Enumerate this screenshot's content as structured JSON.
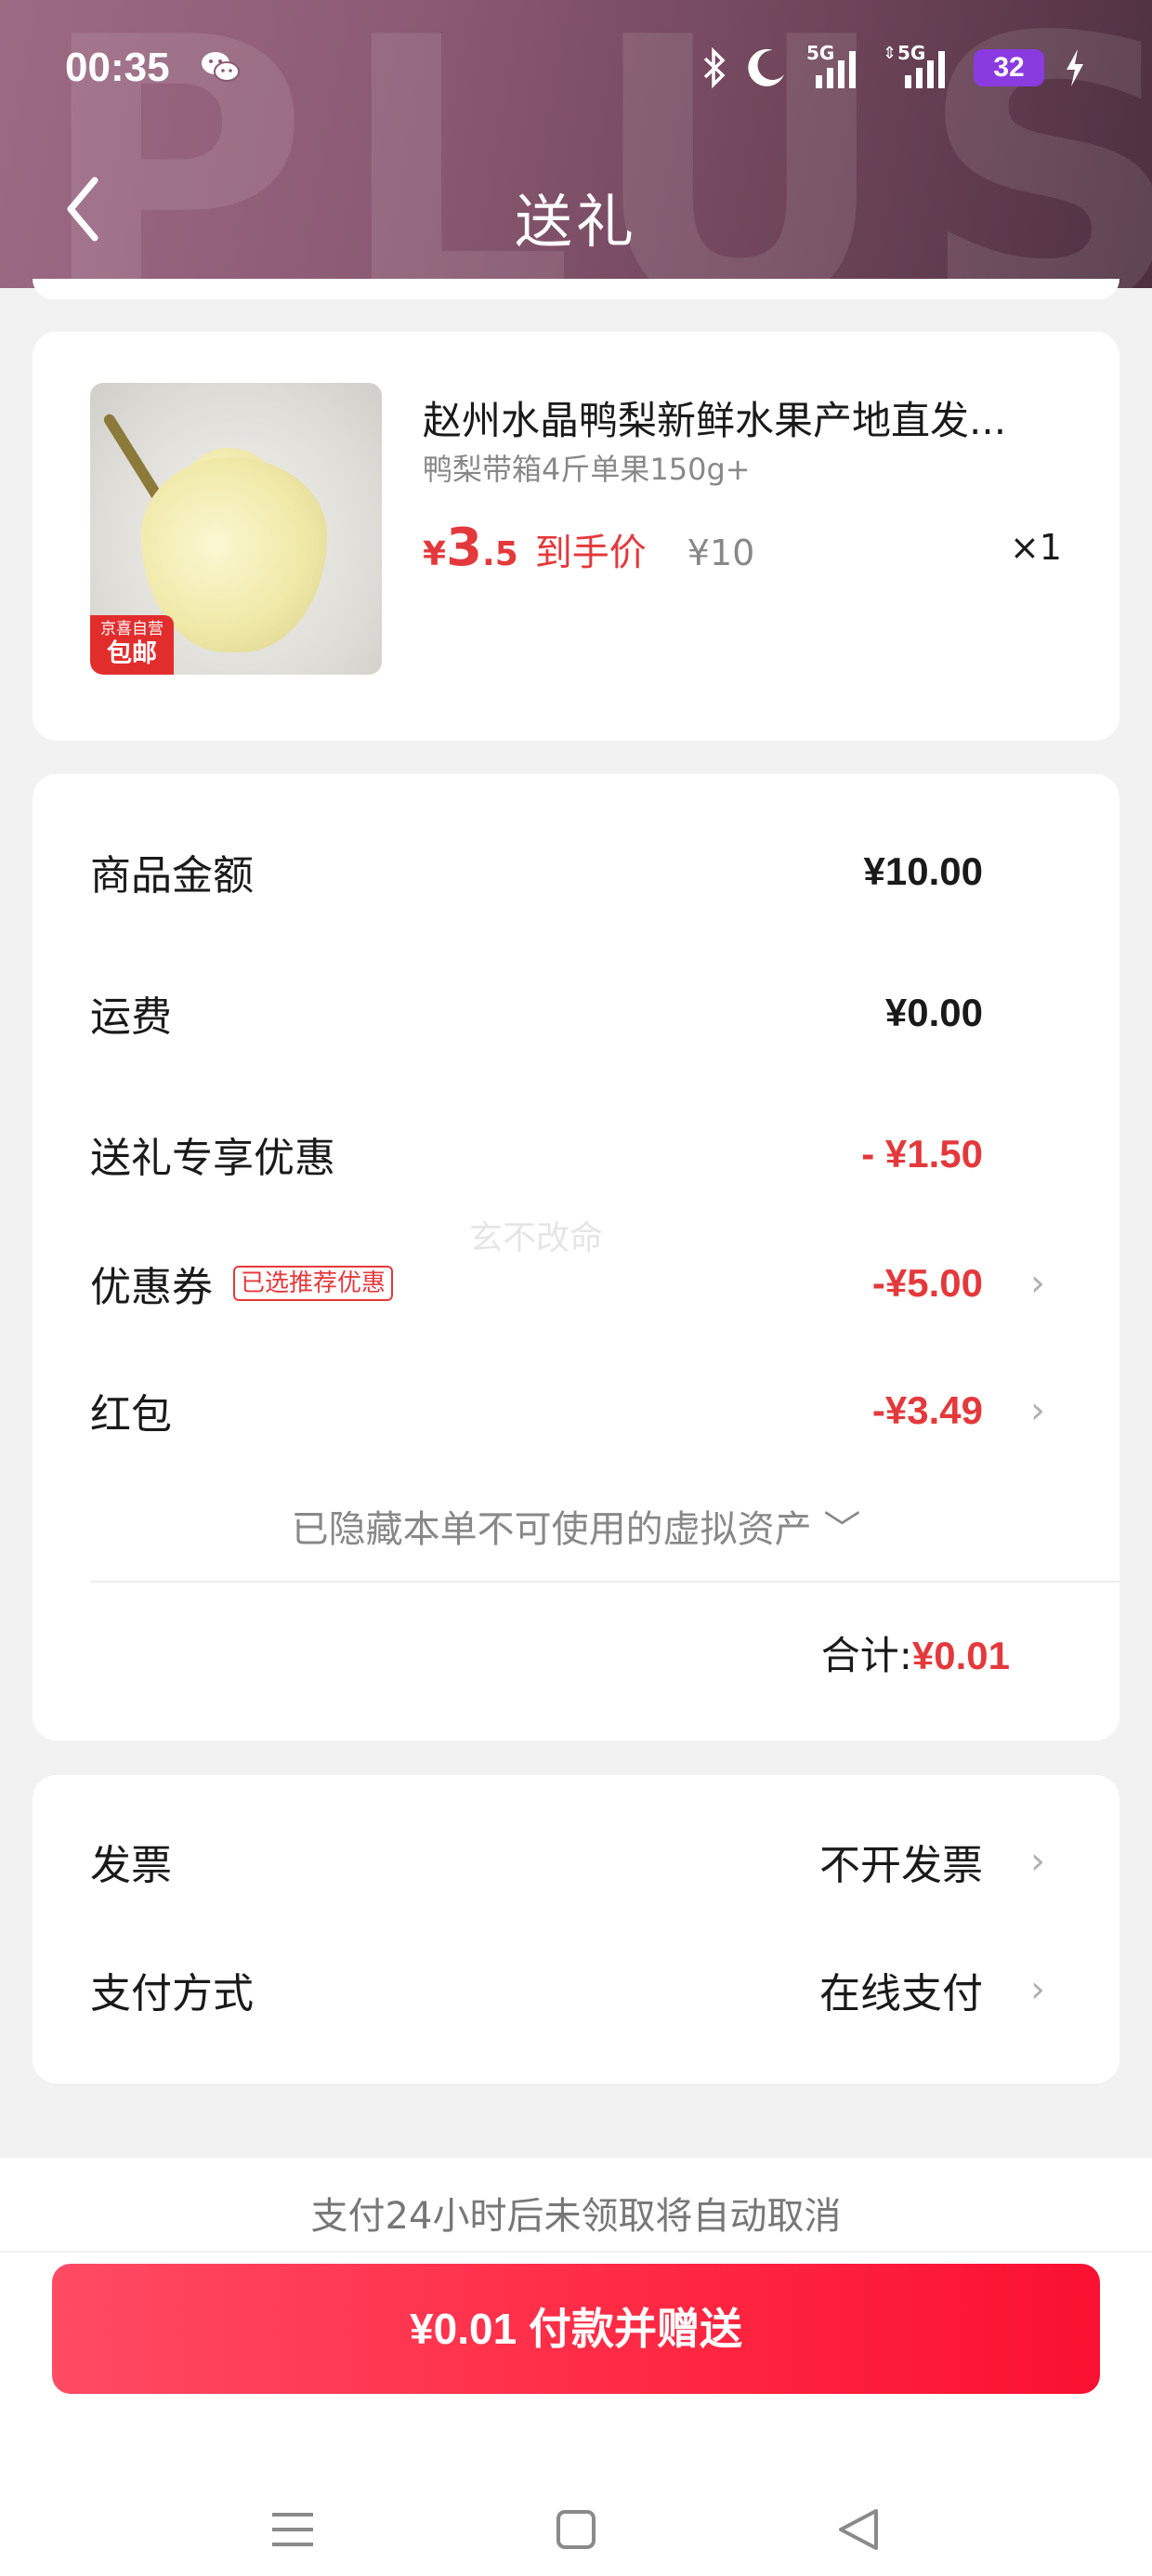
{
  "status_bar": {
    "time": "00:35",
    "network_1": "5G",
    "network_2": "5G",
    "battery": "32",
    "icons": [
      "wechat-icon",
      "bluetooth-icon",
      "moon-icon",
      "signal-icon",
      "signal-icon",
      "charging-icon"
    ]
  },
  "header": {
    "title": "送礼",
    "background_word": "PLUS",
    "gradient_start": "#9d6a84",
    "gradient_end": "#4d3040"
  },
  "product": {
    "title": "赵州水晶鸭梨新鲜水果产地直发...",
    "spec": "鸭梨带箱4斤单果150g+",
    "badge_top": "京喜自营",
    "badge_bottom": "包邮",
    "price_currency": "¥",
    "price_int": "3",
    "price_dec": ".5",
    "price_label": "到手价",
    "original_price": "¥10",
    "quantity": "×1"
  },
  "costs": {
    "rows": [
      {
        "label": "商品金额",
        "value": "¥10.00"
      },
      {
        "label": "运费",
        "value": "¥0.00"
      },
      {
        "label": "送礼专享优惠",
        "value": "- ¥1.50"
      },
      {
        "label": "优惠券",
        "tag": "已选推荐优惠",
        "value": "-¥5.00"
      },
      {
        "label": "红包",
        "value": "-¥3.49"
      }
    ],
    "hidden_assets": "已隐藏本单不可使用的虚拟资产 ﹀",
    "total_label": "合计:",
    "total_value": "¥0.01",
    "watermark": "玄不改命"
  },
  "invoice": {
    "invoice_label": "发票",
    "invoice_value": "不开发票",
    "payment_label": "支付方式",
    "payment_value": "在线支付"
  },
  "footer": {
    "notice": "支付24小时后未领取将自动取消",
    "pay_button": "¥0.01 付款并赠送"
  },
  "colors": {
    "accent_red": "#e4393c",
    "button_red": "#ff2a44"
  }
}
